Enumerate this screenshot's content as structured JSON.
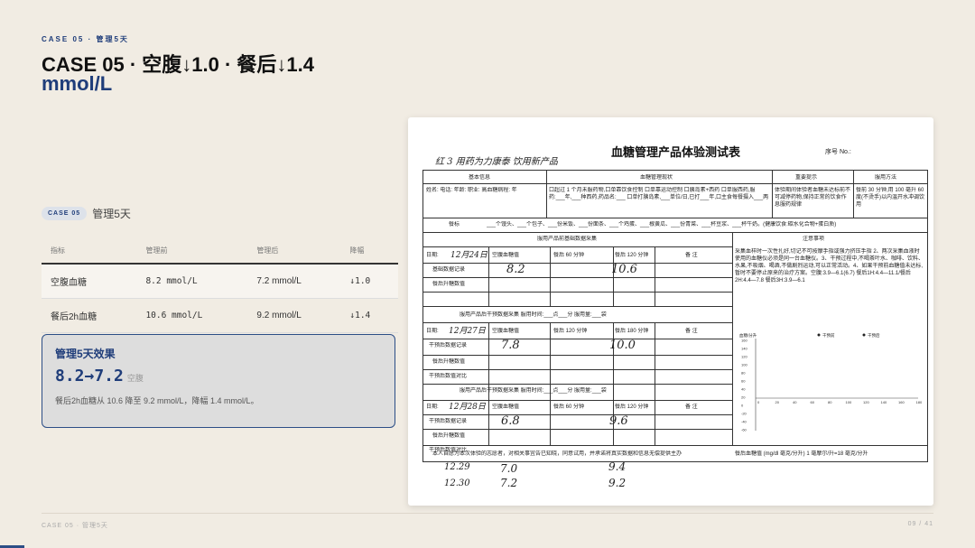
{
  "header": {
    "kicker": "CASE 05 · 管理5天",
    "title_line1": "CASE 05 · 空腹↓1.0 · 餐后↓1.4",
    "title_line2": "mmol/L"
  },
  "case_tag": {
    "pill": "CASE 05",
    "text": "管理5天"
  },
  "table": {
    "headers": [
      "指标",
      "管理前",
      "管理后",
      "降幅"
    ],
    "rows": [
      {
        "metric": "空腹血糖",
        "before": "8.2 mmol/L",
        "after": "7.2 mmol/L",
        "drop": "↓1.0"
      },
      {
        "metric": "餐后2h血糖",
        "before": "10.6 mmol/L",
        "after": "9.2 mmol/L",
        "drop": "↓1.4"
      }
    ]
  },
  "effect": {
    "heading": "管理5天效果",
    "value": "8.2→7.2",
    "value_label": "空腹",
    "desc": "餐后2h血糖从 10.6 降至 9.2 mmol/L，降幅 1.4 mmol/L。"
  },
  "footer": {
    "left": "CASE 05 · 管理5天",
    "right": "09 / 41"
  },
  "document": {
    "title": "血糖管理产品体验测试表",
    "serial_label": "序号 No.:",
    "handwritten_top": "红 3    用药为力康泰 饮用新产品",
    "sections": {
      "basic_info": "基本信息",
      "status": "血糖管理现状",
      "tips": "重要提示",
      "usage": "服用方法",
      "meal": "餐标",
      "base_collect": "服用产品前基础数据采集",
      "notes": "注意事项",
      "intervene1": "服用产品后干预数据采集  服用时间:___点___分  服用量:___袋",
      "intervene2": "服用产品后干预数据采集  服用时间:___点___分  服用量:___袋",
      "consent": "本人自愿为本次体验的志愿者，对相关事宜告已知晓，同意试用，并承诺将真实数据和信息无偿提供主办",
      "unit_note": "餐后血糖值 (mg/dl 毫克/分升) 1 毫摩尔/升=18 毫克/分升"
    },
    "info_fields": "姓名:  电话:  年龄:  职业:  高血糖病程:  年",
    "status_text": "口超过 1 个月未服药物,口单靠饮食控制 口单靠运动控制 口胰岛素+西药 口单服西药,服药:___年,___种西药,药品名:___ 口单打胰岛素,___单位/日,已打___年,口主食每餐摄入___两",
    "tips_text": "体验期间体验者血糖未达标前不可减停药物,保持正常的饮食作息服药规律",
    "usage_text": "餐前 30 分钟,用 100 毫升 60 度(不烫手)以内温开水冲调饮用",
    "meal_text": "___个馒头、___个包子、___份米饭、___份面条、___个鸡蛋、___根黄瓜、___份青菜、___杯豆浆、___杯牛奶。(健康饮食:碳水化合物+蛋白质)",
    "notes_text": "采集血样时一次性扎好,切记不可按摩手指或强力挤压手指 2、两次采集血液时使用的血糖仪必须是同一台血糖仪。3、干预过程中,不喝茶叶水、咖啡、饮料、水果,不吸烟、喝酒,不做剧烈运动,可以正常活动。4、如果干预前血糖值未达标,暂时不要停止原来的治疗方案。空腹:3.9—6.1(6.7) 餐后1H:4.4—11.1/餐后2H:4.4—7.8 餐后3H:3.9—6.1",
    "col_headers_a": [
      "空腹血糖值",
      "餐后 60 分钟",
      "餐后 120 分钟",
      "备  注"
    ],
    "col_headers_b": [
      "空腹血糖值",
      "餐后 120 分钟",
      "餐后 180 分钟",
      "备  注"
    ],
    "col_headers_c": [
      "空腹血糖值",
      "餐后 60 分钟",
      "餐后 120 分钟",
      "备  注"
    ],
    "row_labels_a": [
      "基础数据记录",
      "餐后升糖数值"
    ],
    "row_labels_b": [
      "干预后数据记录",
      "餐后升糖数值",
      "干预后数值对比"
    ],
    "row_labels_c": [
      "干预后数据记录",
      "餐后升糖数值",
      "干预后数值对比"
    ],
    "date_label": "日期:",
    "handwritten": {
      "date1": "12月24日",
      "fasting1": "8.2",
      "post1": "10.6",
      "date2": "12月27日",
      "fasting2": "7.8",
      "post2": "10.0",
      "date3": "12月28日",
      "fasting3": "6.8",
      "post3": "9.6",
      "extra1_date": "12.29",
      "extra1_fasting": "7.0",
      "extra1_post": "9.4",
      "extra2_date": "12.30",
      "extra2_fasting": "7.2",
      "extra2_post": "9.2"
    },
    "mini_chart": {
      "legend": [
        "干预前",
        "干预后"
      ],
      "y_ticks": [
        "160",
        "140",
        "120",
        "100",
        "80",
        "60",
        "40",
        "20",
        "0",
        "-20",
        "-40",
        "-60"
      ],
      "x_ticks": [
        "0",
        "20",
        "40",
        "60",
        "80",
        "100",
        "120",
        "140",
        "160",
        "180"
      ],
      "y_label": "血糖/分升"
    }
  }
}
